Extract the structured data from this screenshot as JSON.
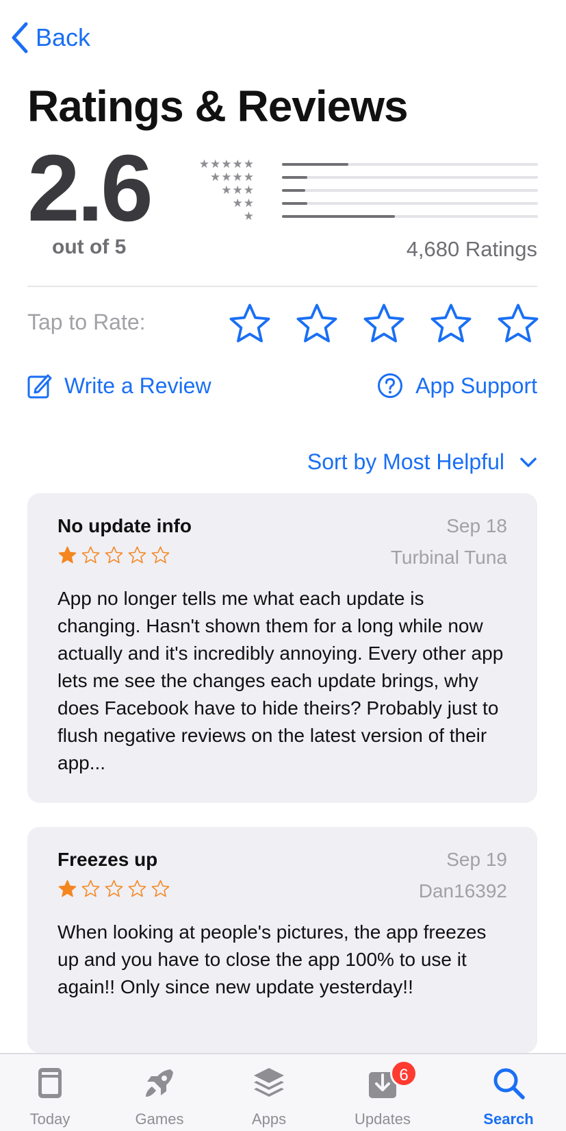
{
  "nav": {
    "back_label": "Back"
  },
  "page_title": "Ratings & Reviews",
  "summary": {
    "score": "2.6",
    "out_of": "out of 5",
    "ratings_count": "4,680 Ratings",
    "distribution": [
      {
        "stars": 5,
        "fraction": 0.26
      },
      {
        "stars": 4,
        "fraction": 0.1
      },
      {
        "stars": 3,
        "fraction": 0.09
      },
      {
        "stars": 2,
        "fraction": 0.1
      },
      {
        "stars": 1,
        "fraction": 0.44
      }
    ]
  },
  "tap_to_rate": {
    "label": "Tap to Rate:",
    "star_count": 5
  },
  "actions": {
    "write_review": "Write a Review",
    "app_support": "App Support"
  },
  "sort": {
    "label": "Sort by Most Helpful"
  },
  "reviews": [
    {
      "title": "No update info",
      "date": "Sep 18",
      "author": "Turbinal Tuna",
      "rating": 1,
      "body": "App no longer tells me what each update is changing. Hasn't shown them for a long while now actually and it's incredibly annoying. Every other app lets me see the changes each update brings, why does Facebook have to hide theirs? Probably just to flush negative reviews on the latest version of their app..."
    },
    {
      "title": "Freezes up",
      "date": "Sep 19",
      "author": "Dan16392",
      "rating": 1,
      "body": "When looking at people's pictures, the app freezes up and you have to close the app 100% to use it again!! Only since new update yesterday!!"
    }
  ],
  "tabbar": {
    "tabs": [
      {
        "label": "Today",
        "icon": "today-icon"
      },
      {
        "label": "Games",
        "icon": "rocket-icon"
      },
      {
        "label": "Apps",
        "icon": "layers-icon"
      },
      {
        "label": "Updates",
        "icon": "download-tray-icon",
        "badge": "6"
      },
      {
        "label": "Search",
        "icon": "search-icon",
        "active": true
      }
    ]
  },
  "colors": {
    "accent": "#1a6ff4",
    "review_star": "#f5861f",
    "card_background": "#efeff4",
    "badge": "#ff3b30"
  }
}
